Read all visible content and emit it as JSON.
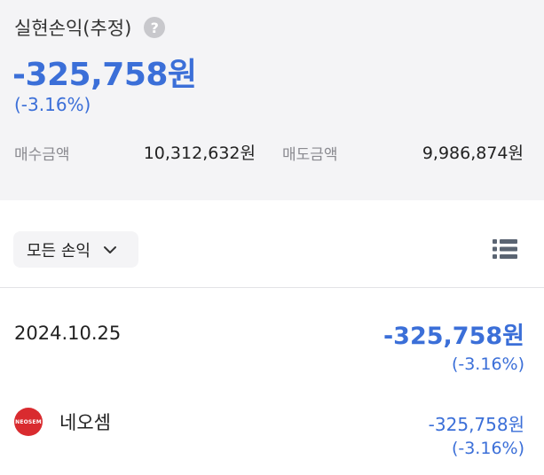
{
  "summary": {
    "title": "실현손익(추정)",
    "help_icon": "?",
    "total_amount": "-325,758원",
    "total_rate": "(-3.16%)",
    "buy_label": "매수금액",
    "buy_value": "10,312,632원",
    "sell_label": "매도금액",
    "sell_value": "9,986,874원"
  },
  "filter": {
    "label": "모든 손익",
    "icon": "chevron-down-icon"
  },
  "view_toggle_icon": "list-icon",
  "records": [
    {
      "date": "2024.10.25",
      "amount": "-325,758원",
      "rate": "(-3.16%)",
      "stocks": [
        {
          "logo_text": "NEOSEM",
          "name": "네오셈",
          "amount": "-325,758원",
          "rate": "(-3.16%)"
        }
      ]
    }
  ],
  "colors": {
    "loss_blue": "#3b6fd8",
    "summary_bg": "#f4f4f6",
    "logo_red": "#d92b2f"
  }
}
